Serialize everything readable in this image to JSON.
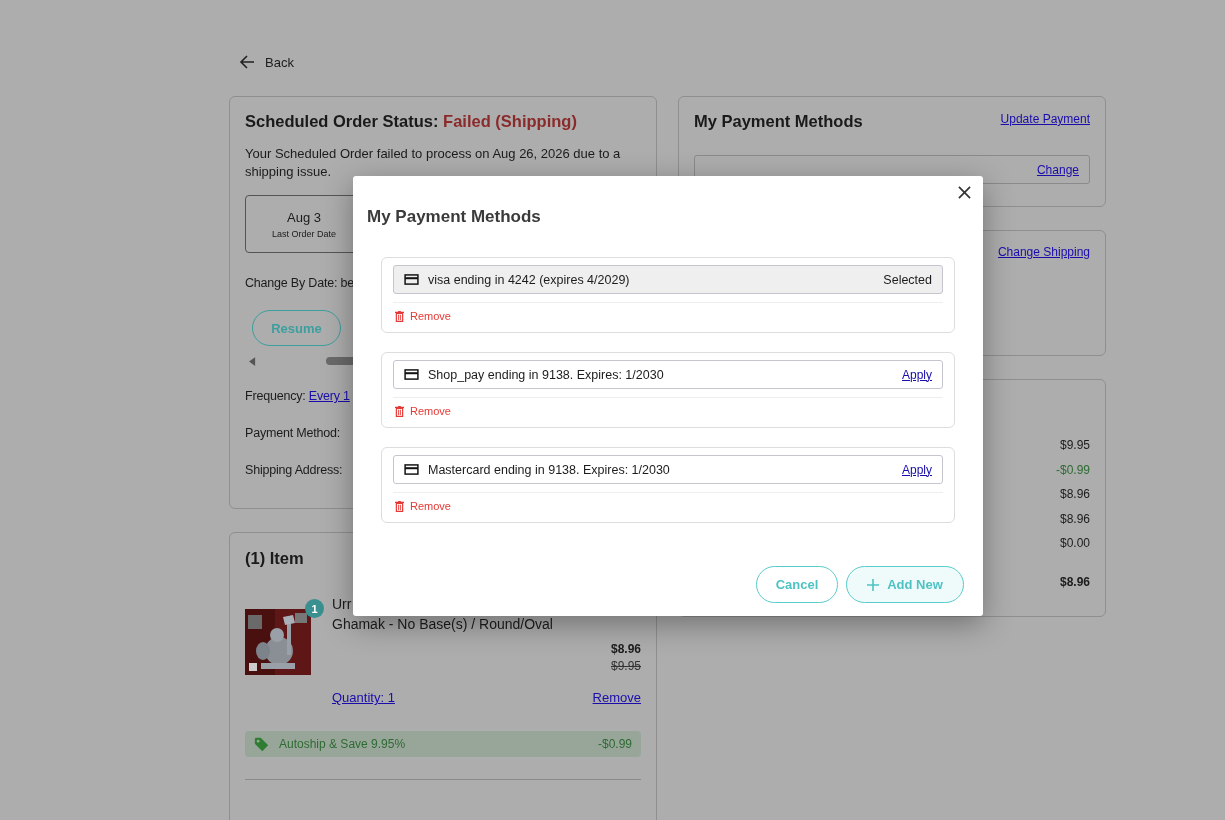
{
  "back": "Back",
  "order_status": {
    "title": "Scheduled Order Status:",
    "status": "Failed (Shipping)",
    "message": "Your Scheduled Order failed to process on Aug 26, 2026 due to a shipping issue.",
    "dates": [
      {
        "date": "Aug 3",
        "label": "Last Order Date"
      }
    ],
    "change_by": "Change By Date: be",
    "buttons": [
      "Resume"
    ],
    "frequency_label": "Frequency:",
    "frequency_value": "Every 1",
    "payment_label": "Payment Method:",
    "shipping_label": "Shipping Address:"
  },
  "items_card": {
    "title": "(1) Item",
    "items": [
      {
        "quantity_badge": "1",
        "name_lines": [
          "Urr",
          "Ghamak - No Base(s) / Round/Oval"
        ],
        "price": "$8.96",
        "original_price": "$9.95",
        "quantity_link": "Quantity: 1",
        "remove": "Remove"
      }
    ],
    "discount": {
      "label": "Autoship & Save 9.95%",
      "amount": "-$0.99"
    }
  },
  "payment_card": {
    "title": "My Payment Methods",
    "link": "Update Payment",
    "change": "Change"
  },
  "shipping_card": {
    "link": "Change Shipping"
  },
  "summary": {
    "values": [
      {
        "value": "$9.95",
        "kind": "normal"
      },
      {
        "value": "-$0.99",
        "kind": "discount"
      },
      {
        "value": "$8.96",
        "kind": "normal"
      },
      {
        "value": "$8.96",
        "kind": "normal"
      },
      {
        "value": "$0.00",
        "kind": "normal"
      },
      {
        "value": "$8.96",
        "kind": "total"
      }
    ]
  },
  "modal": {
    "title": "My Payment Methods",
    "methods": [
      {
        "label": "visa ending in 4242 (expires 4/2029)",
        "selected": true,
        "status": "Selected",
        "remove": "Remove"
      },
      {
        "label": "Shop_pay ending in 9138. Expires: 1/2030",
        "selected": false,
        "action": "Apply",
        "remove": "Remove"
      },
      {
        "label": "Mastercard ending in 9138. Expires: 1/2030",
        "selected": false,
        "action": "Apply",
        "remove": "Remove"
      }
    ],
    "cancel": "Cancel",
    "add": "Add New"
  }
}
